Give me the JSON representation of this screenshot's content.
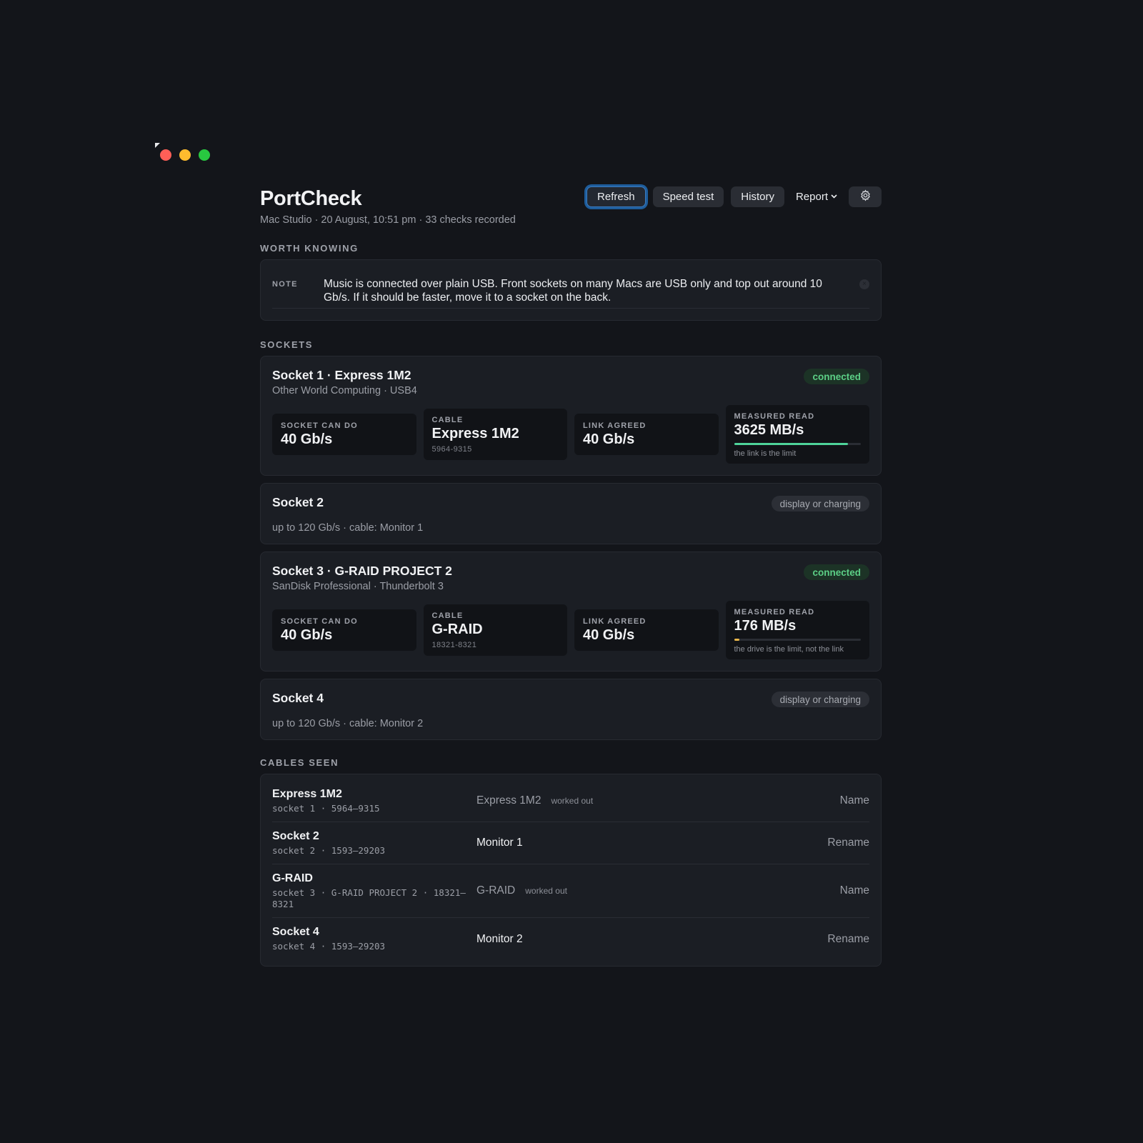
{
  "window": {
    "controls": [
      "close",
      "minimize",
      "zoom"
    ]
  },
  "header": {
    "title": "PortCheck",
    "subtitle": "Mac Studio · 20 August, 10:51 pm · 33 checks recorded"
  },
  "toolbar": {
    "refresh": "Refresh",
    "speed_test": "Speed test",
    "history": "History",
    "report": "Report",
    "settings_icon": "gear-icon"
  },
  "worth_knowing": {
    "label": "WORTH KNOWING",
    "note_tag": "NOTE",
    "note_text": "Music is connected over plain USB. Front sockets on many Macs are USB only and top out around 10 Gb/s. If it should be faster, move it to a socket on the back.",
    "close_icon": "close-icon"
  },
  "sockets": {
    "label": "SOCKETS",
    "items": [
      {
        "title": "Socket 1 · Express 1M2",
        "subtitle": "Other World Computing · USB4",
        "status": "connected",
        "can_do_label": "SOCKET CAN DO",
        "can_do": "40 Gb/s",
        "cable_label": "CABLE",
        "cable": "Express 1M2",
        "cable_id": "5964-9315",
        "link_label": "LINK AGREED",
        "link": "40 Gb/s",
        "read_label": "MEASURED READ",
        "read": "3625 MB/s",
        "read_fraction": 0.9,
        "read_color": "#4fd49a",
        "read_note": "the link is the limit"
      },
      {
        "title": "Socket 2",
        "status": "display or charging",
        "detail": "up to 120 Gb/s · cable: Monitor 1"
      },
      {
        "title": "Socket 3 · G-RAID PROJECT 2",
        "subtitle": "SanDisk Professional · Thunderbolt 3",
        "status": "connected",
        "can_do_label": "SOCKET CAN DO",
        "can_do": "40 Gb/s",
        "cable_label": "CABLE",
        "cable": "G-RAID",
        "cable_id": "18321-8321",
        "link_label": "LINK AGREED",
        "link": "40 Gb/s",
        "read_label": "MEASURED READ",
        "read": "176 MB/s",
        "read_fraction": 0.04,
        "read_color": "#e8b64a",
        "read_note": "the drive is the limit, not the link"
      },
      {
        "title": "Socket 4",
        "status": "display or charging",
        "detail": "up to 120 Gb/s · cable: Monitor 2"
      }
    ]
  },
  "cables": {
    "label": "CABLES SEEN",
    "rows": [
      {
        "name": "Express 1M2",
        "meta": "socket 1 · 5964–9315",
        "value": "Express 1M2",
        "tag": "worked out",
        "action": "Name"
      },
      {
        "name": "Socket 2",
        "meta": "socket 2 · 1593–29203",
        "value": "Monitor 1",
        "tag": "",
        "action": "Rename"
      },
      {
        "name": "G-RAID",
        "meta": "socket 3 · G-RAID PROJECT 2 · 18321–8321",
        "value": "G-RAID",
        "tag": "worked out",
        "action": "Name"
      },
      {
        "name": "Socket 4",
        "meta": "socket 4 · 1593–29203",
        "value": "Monitor 2",
        "tag": "",
        "action": "Rename"
      }
    ]
  },
  "colors": {
    "background": "#13151a",
    "card": "#1b1e24",
    "accent": "#1e5d9c",
    "connected": "#5ccf86"
  }
}
